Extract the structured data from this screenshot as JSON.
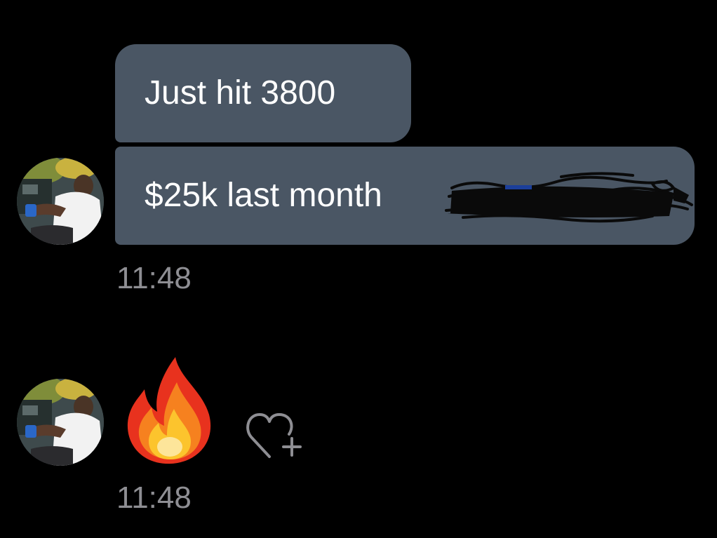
{
  "conversation": {
    "messages": [
      {
        "text": "Just hit 3800"
      },
      {
        "text": "$25k last month"
      }
    ],
    "group_time": "11:48",
    "reaction": {
      "emoji_name": "fire-emoji",
      "time": "11:48"
    }
  },
  "colors": {
    "background": "#000000",
    "bubble": "#4a5664",
    "text": "#ffffff",
    "timestamp": "#8e8e93"
  },
  "icons": {
    "reaction_add": "heart-plus-icon",
    "redaction": "scribble-redaction"
  }
}
